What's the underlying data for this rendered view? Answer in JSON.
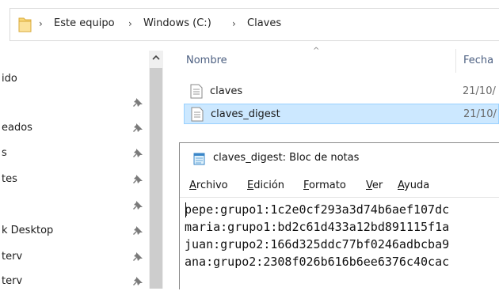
{
  "address_bar": {
    "crumbs": [
      "Este equipo",
      "Windows (C:)",
      "Claves"
    ],
    "separator": "›"
  },
  "nav_pane": {
    "items": [
      {
        "label": "ido",
        "pinned": false
      },
      {
        "label": "",
        "pinned": true
      },
      {
        "label": "eados",
        "pinned": true
      },
      {
        "label": "s",
        "pinned": true
      },
      {
        "label": "tes",
        "pinned": true
      },
      {
        "label": "",
        "pinned": true
      },
      {
        "label": "k Desktop",
        "pinned": true
      },
      {
        "label": "terv",
        "pinned": true
      },
      {
        "label": "terv",
        "pinned": true
      }
    ]
  },
  "file_list": {
    "columns": {
      "name": "Nombre",
      "date": "Fecha"
    },
    "files": [
      {
        "name": "claves",
        "date": "21/10/",
        "selected": false
      },
      {
        "name": "claves_digest",
        "date": "21/10/",
        "selected": true
      }
    ]
  },
  "notepad": {
    "title": "claves_digest: Bloc de notas",
    "menu": [
      {
        "accel": "A",
        "rest": "rchivo"
      },
      {
        "accel": "E",
        "rest": "dición"
      },
      {
        "accel": "F",
        "rest": "ormato"
      },
      {
        "accel": "V",
        "rest": "er"
      },
      {
        "accel": "A",
        "rest": "yuda"
      }
    ],
    "lines": [
      "pepe:grupo1:1c2e0cf293a3d74b6aef107dc",
      "maria:grupo1:bd2c61d433a12bd891115f1a",
      "juan:grupo2:166d325ddc77bf0246adbcba9",
      "ana:grupo2:2308f026b616b6ee6376c40cac"
    ]
  },
  "colors": {
    "selection_bg": "#cce8ff",
    "selection_border": "#99d1ff",
    "header_text": "#4d6082",
    "folder_yellow": "#f8d775"
  }
}
